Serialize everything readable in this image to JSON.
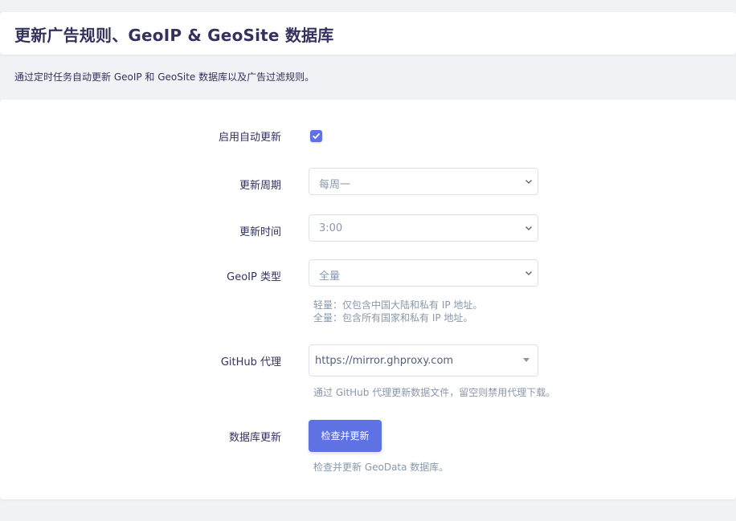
{
  "header": {
    "title": "更新广告规则、GeoIP & GeoSite 数据库"
  },
  "description": "通过定时任务自动更新 GeoIP 和 GeoSite 数据库以及广告过滤规则。",
  "form": {
    "auto_update": {
      "label": "启用自动更新",
      "checked": true
    },
    "update_period": {
      "label": "更新周期",
      "value": "每周一"
    },
    "update_time": {
      "label": "更新时间",
      "value": "3:00"
    },
    "geoip_type": {
      "label": "GeoIP 类型",
      "value": "全量",
      "help_line1": "轻量：仅包含中国大陆和私有 IP 地址。",
      "help_line2": "全量：包含所有国家和私有 IP 地址。"
    },
    "github_proxy": {
      "label": "GitHub 代理",
      "value": "https://mirror.ghproxy.com",
      "help": "通过 GitHub 代理更新数据文件，留空则禁用代理下载。"
    },
    "db_update": {
      "label": "数据库更新",
      "button_label": "检查并更新",
      "help": "检查并更新 GeoData 数据库。"
    }
  },
  "colors": {
    "accent": "#5e72e4",
    "text": "#32325d",
    "muted": "#8898aa",
    "background": "#f1f2f6"
  },
  "icons": {
    "checkbox_mark": "check-icon",
    "select_arrow": "chevron-down-icon",
    "combo_arrow": "caret-down-icon"
  }
}
